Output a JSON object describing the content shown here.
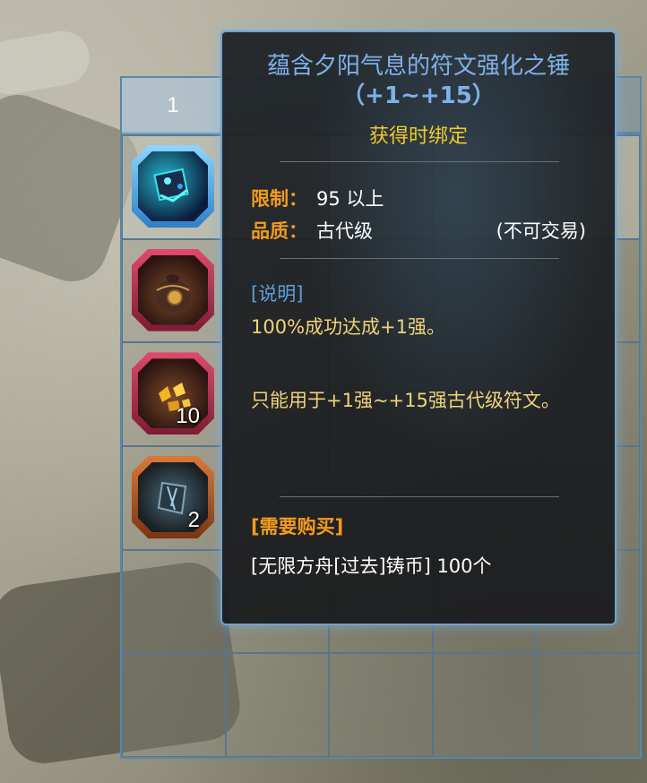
{
  "inventory": {
    "tab_label": "1",
    "items": [
      {
        "icon": "rune-hammer-icon",
        "quantity": ""
      },
      {
        "icon": "coin-pouch-icon",
        "quantity": ""
      },
      {
        "icon": "gold-fragments-icon",
        "quantity": "10"
      },
      {
        "icon": "dark-crystal-shard-icon",
        "quantity": "2"
      }
    ]
  },
  "tooltip": {
    "title_line1": "蕴含夕阳气息的符文强化之锤",
    "title_line2": "（+1~+15）",
    "binding": "获得时绑定",
    "limit_label": "限制：",
    "limit_value": "95 以上",
    "quality_label": "品质：",
    "quality_value": "古代级",
    "trade_note": "(不可交易)",
    "description_header": "[说明]",
    "description_line1": "100%成功达成+1强。",
    "description_line2": "只能用于+1强~+15强古代级符文。",
    "purchase_header": "[需要购买]",
    "purchase_cost": "[无限方舟[过去]铸币] 100个"
  },
  "colors": {
    "title": "#7fb1ea",
    "binding": "#f2c92b",
    "label": "#f39b1e",
    "description": "#f0d37a",
    "frame_border": "#6fa3cf"
  }
}
